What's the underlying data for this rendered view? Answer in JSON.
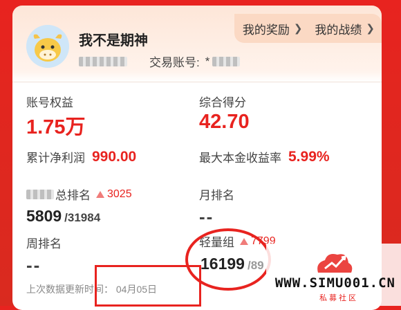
{
  "header": {
    "username": "我不是期神",
    "account_label": "交易账号:",
    "account_value": "*",
    "links": [
      {
        "label": "我的奖励",
        "icon": "chevron-right-icon"
      },
      {
        "label": "我的战绩",
        "icon": "chevron-right-icon"
      }
    ]
  },
  "stats": {
    "equity_label": "账号权益",
    "equity_value": "1.75万",
    "score_label": "综合得分",
    "score_value": "42.70",
    "net_profit_label": "累计净利润",
    "net_profit_value": "990.00",
    "max_return_label": "最大本金收益率",
    "max_return_value": "5.99%"
  },
  "rankings": {
    "total_label": "总排名",
    "total_change": "3025",
    "total_rank": "5809",
    "total_count": "/31984",
    "month_label": "月排名",
    "month_rank": "--",
    "week_label": "周排名",
    "week_rank": "--",
    "group_label": "轻量组",
    "group_change": "7799",
    "group_rank": "16199",
    "group_count": "/89"
  },
  "footer": {
    "update_label": "上次数据更新时间：",
    "update_value": "04月05日"
  },
  "watermark": {
    "site": "WWW.SIMU001.CN",
    "tag": "私募社区"
  },
  "colors": {
    "background": "#e8231f",
    "accent": "#e8231f",
    "link_bar": "#fbd9c4"
  }
}
